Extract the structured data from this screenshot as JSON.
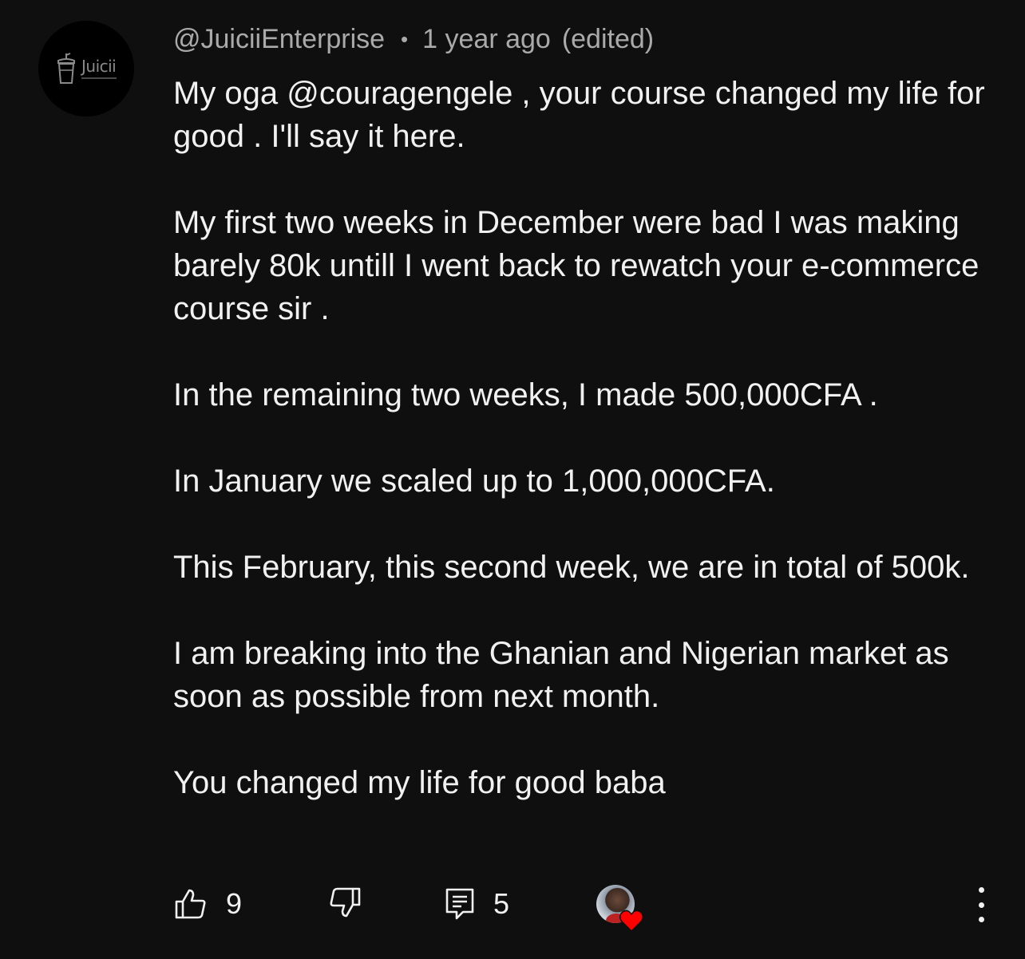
{
  "comment": {
    "avatar": {
      "brand_text": "Juicii",
      "icon": "cup-icon"
    },
    "author": "@JuiciiEnterprise",
    "separator": "•",
    "time_ago": "1 year ago",
    "edited_label": "(edited)",
    "paragraphs": [
      "My oga @couragengele , your course changed my life for good . I'll say it here.",
      "My first two weeks in December were bad I was making barely 80k untill I went back to rewatch your e-commerce course sir .",
      "In the remaining two weeks, I made 500,000CFA .",
      "In January we scaled up to 1,000,000CFA.",
      "This February, this second week, we are in total of 500k.",
      "I am breaking into the Ghanian and Nigerian market as soon as possible from next month.",
      "You changed my life for good baba"
    ]
  },
  "actions": {
    "like_icon": "thumbs-up-icon",
    "like_count": "9",
    "dislike_icon": "thumbs-down-icon",
    "reply_icon": "reply-icon",
    "reply_count": "5",
    "creator_heart_icon": "heart-icon",
    "heart_color": "#ff0000",
    "more_icon": "more-vertical-icon"
  },
  "colors": {
    "background": "#0f0f0f",
    "text": "#f1f1f1",
    "secondary_text": "#aaaaaa"
  }
}
